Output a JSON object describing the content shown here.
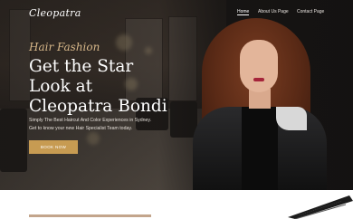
{
  "header": {
    "logo": "Cleopatra",
    "nav": [
      {
        "label": "Home",
        "active": true
      },
      {
        "label": "About Us Page",
        "active": false
      },
      {
        "label": "Contact Page",
        "active": false
      }
    ]
  },
  "hero": {
    "subtitle": "Hair Fashion",
    "headline_lines": [
      "Get the Star",
      "Look at",
      "Cleopatra Bondi"
    ],
    "description_lines": [
      "Simply The Best Haircut And Color Experiences in Sydney.",
      "Get to know your new Hair Specialist Team today."
    ],
    "cta_label": "BOOK NOW"
  },
  "colors": {
    "accent": "#c79b52",
    "subtitle": "#d8b88a",
    "hero_dark": "#1a1817"
  },
  "icons": [
    "scissors-icon"
  ]
}
